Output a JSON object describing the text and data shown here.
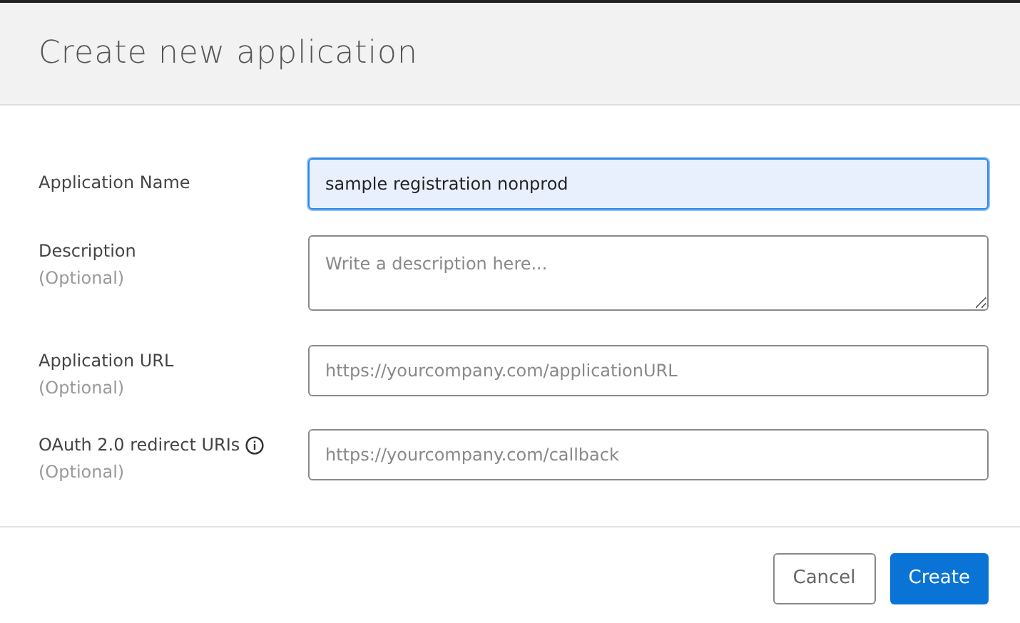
{
  "dialog": {
    "title": "Create new application"
  },
  "fields": [
    {
      "label": "Application Name",
      "kind": "input",
      "value": "sample registration nonprod",
      "focused": true,
      "info": false
    },
    {
      "label": "Description",
      "optional": "(Optional)",
      "kind": "textarea",
      "placeholder": "Write a description here...",
      "focused": false,
      "info": false
    },
    {
      "label": "Application URL",
      "optional": "(Optional)",
      "kind": "input",
      "placeholder": "https://yourcompany.com/applicationURL",
      "focused": false,
      "info": false
    },
    {
      "label": "OAuth 2.0 redirect URIs",
      "optional": "(Optional)",
      "kind": "input",
      "placeholder": "https://yourcompany.com/callback",
      "focused": false,
      "info": true
    }
  ],
  "buttons": [
    {
      "label": "Cancel",
      "kind": "secondary"
    },
    {
      "label": "Create",
      "kind": "primary"
    }
  ]
}
